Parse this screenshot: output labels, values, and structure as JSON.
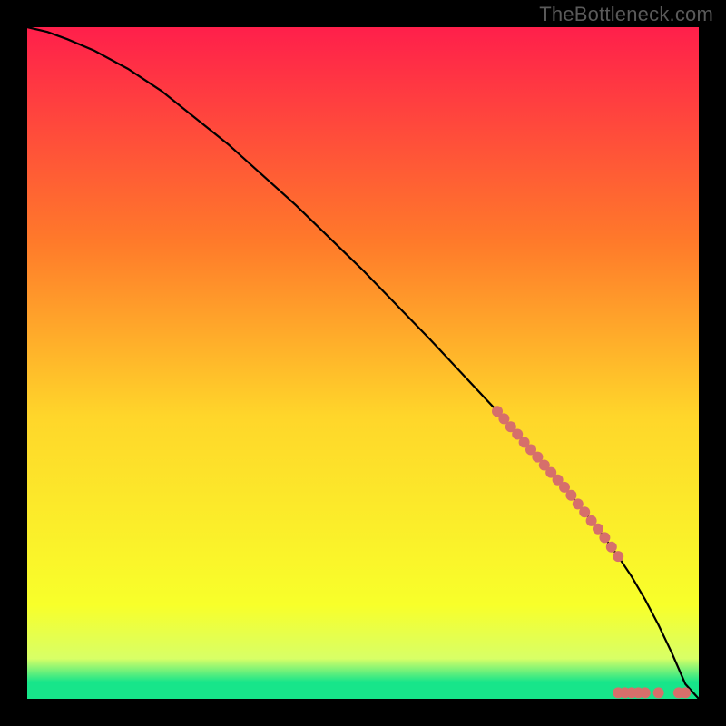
{
  "watermark": "TheBottleneck.com",
  "chart_data": {
    "type": "line",
    "title": "",
    "xlabel": "",
    "ylabel": "",
    "xlim": [
      0,
      100
    ],
    "ylim": [
      0,
      100
    ],
    "grid": false,
    "legend": false,
    "colors": {
      "gradient_top": "#ff1f4b",
      "gradient_mid_upper": "#ff7a2a",
      "gradient_mid": "#ffd62a",
      "gradient_lower": "#f8ff2a",
      "gradient_band": "#d8ff66",
      "gradient_bottom": "#17e58a",
      "curve": "#000000",
      "points": "#d66f6b"
    },
    "curve": {
      "x": [
        0,
        3,
        6,
        10,
        15,
        20,
        30,
        40,
        50,
        60,
        70,
        80,
        85,
        88,
        90,
        92,
        94,
        96,
        98,
        100
      ],
      "y": [
        100,
        99.3,
        98.2,
        96.5,
        93.8,
        90.5,
        82.5,
        73.5,
        63.8,
        53.5,
        42.8,
        31.5,
        25.3,
        21.2,
        18.2,
        14.8,
        11.0,
        6.8,
        2.2,
        0
      ]
    },
    "points_on_curve": {
      "x": [
        70,
        71,
        72,
        73,
        74,
        75,
        76,
        77,
        78,
        79,
        80,
        81,
        82,
        83,
        84,
        85,
        86,
        87,
        88
      ],
      "y": [
        42.8,
        41.7,
        40.5,
        39.4,
        38.2,
        37.1,
        36.0,
        34.8,
        33.7,
        32.6,
        31.5,
        30.3,
        29.0,
        27.8,
        26.5,
        25.3,
        24.0,
        22.6,
        21.2
      ]
    },
    "points_flat": {
      "x": [
        88,
        89,
        90,
        91,
        92,
        94,
        97,
        98
      ],
      "y": [
        0.9,
        0.9,
        0.9,
        0.9,
        0.9,
        0.9,
        0.9,
        0.9
      ]
    }
  }
}
